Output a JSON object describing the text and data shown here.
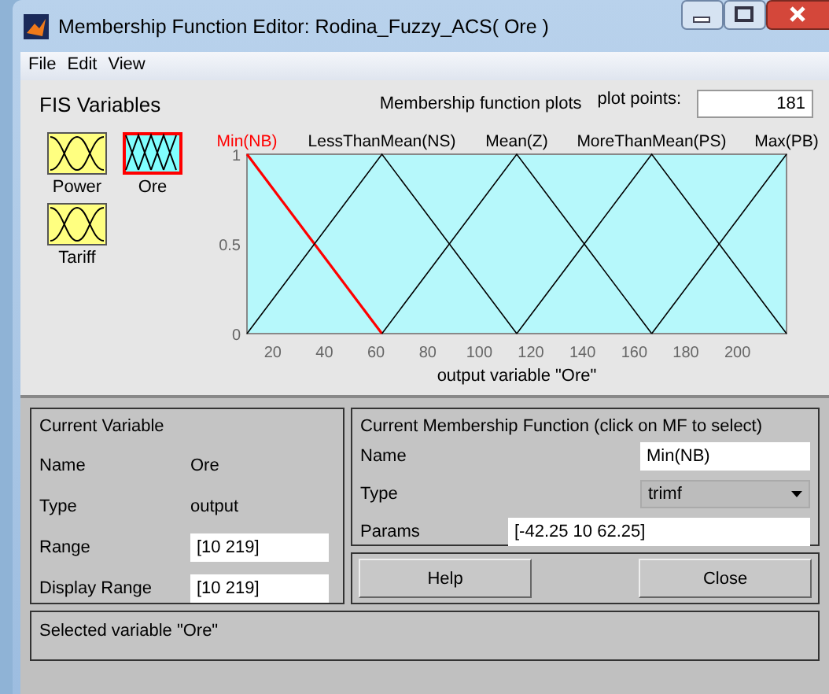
{
  "window": {
    "title": "Membership Function Editor: Rodina_Fuzzy_ACS( Ore )"
  },
  "menu": [
    "File",
    "Edit",
    "View"
  ],
  "fis_variables": {
    "title": "FIS Variables",
    "items": [
      {
        "name": "Power",
        "kind": "input",
        "selected": false
      },
      {
        "name": "Ore",
        "kind": "output",
        "selected": true
      },
      {
        "name": "Tariff",
        "kind": "input",
        "selected": false
      }
    ]
  },
  "plot": {
    "title": "Membership function plots",
    "plot_points_label": "plot points:",
    "plot_points": "181",
    "chart_data": {
      "type": "line",
      "xlabel": "output variable \"Ore\"",
      "x": [
        10,
        62.25,
        114.5,
        166.75,
        219
      ],
      "xlim": [
        10,
        219
      ],
      "ylim": [
        0,
        1
      ],
      "xticks": [
        20,
        40,
        60,
        80,
        100,
        120,
        140,
        160,
        180,
        200
      ],
      "yticks": [
        0,
        0.5,
        1
      ],
      "series": [
        {
          "name": "Min(NB)",
          "color": "#ff0000",
          "values": [
            1,
            0,
            null,
            null,
            null
          ]
        },
        {
          "name": "LessThanMean(NS)",
          "color": "#000000",
          "values": [
            0,
            1,
            0,
            null,
            null
          ]
        },
        {
          "name": "Mean(Z)",
          "color": "#000000",
          "values": [
            null,
            0,
            1,
            0,
            null
          ]
        },
        {
          "name": "MoreThanMean(PS)",
          "color": "#000000",
          "values": [
            null,
            null,
            0,
            1,
            0
          ]
        },
        {
          "name": "Max(PB)",
          "color": "#000000",
          "values": [
            null,
            null,
            null,
            0,
            1
          ]
        }
      ]
    }
  },
  "current_variable": {
    "title": "Current Variable",
    "fields": [
      {
        "label": "Name",
        "value": "Ore",
        "kind": "text"
      },
      {
        "label": "Type",
        "value": "output",
        "kind": "text"
      },
      {
        "label": "Range",
        "value": "[10 219]",
        "kind": "input"
      },
      {
        "label": "Display Range",
        "value": "[10 219]",
        "kind": "input"
      }
    ]
  },
  "current_mf": {
    "title": "Current Membership Function (click on MF to select)",
    "name_label": "Name",
    "name": "Min(NB)",
    "type_label": "Type",
    "type": "trimf",
    "params_label": "Params",
    "params": "[-42.25 10 62.25]"
  },
  "buttons": [
    "Help",
    "Close"
  ],
  "status": "Selected variable \"Ore\""
}
